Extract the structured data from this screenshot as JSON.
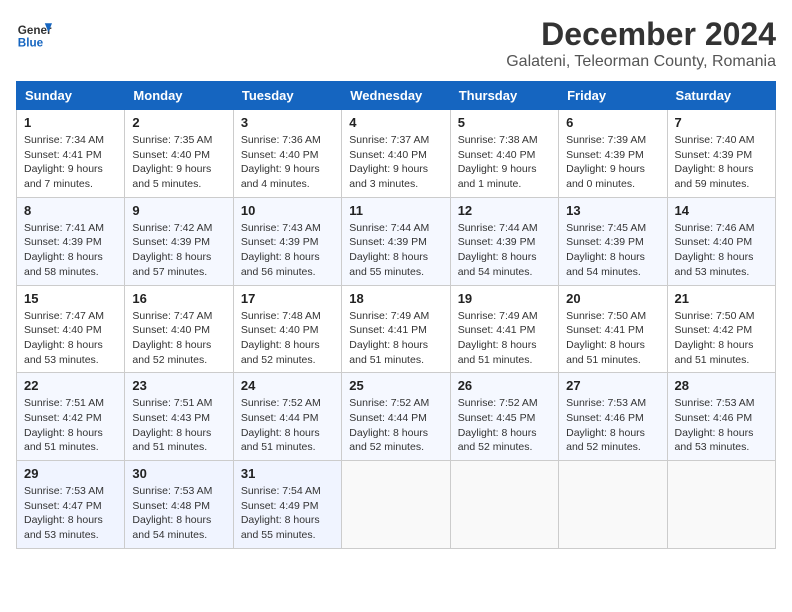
{
  "header": {
    "logo_general": "General",
    "logo_blue": "Blue",
    "month_title": "December 2024",
    "location": "Galateni, Teleorman County, Romania"
  },
  "calendar": {
    "days_of_week": [
      "Sunday",
      "Monday",
      "Tuesday",
      "Wednesday",
      "Thursday",
      "Friday",
      "Saturday"
    ],
    "weeks": [
      [
        null,
        {
          "day": "2",
          "sunrise": "Sunrise: 7:35 AM",
          "sunset": "Sunset: 4:40 PM",
          "daylight": "Daylight: 9 hours and 5 minutes."
        },
        {
          "day": "3",
          "sunrise": "Sunrise: 7:36 AM",
          "sunset": "Sunset: 4:40 PM",
          "daylight": "Daylight: 9 hours and 4 minutes."
        },
        {
          "day": "4",
          "sunrise": "Sunrise: 7:37 AM",
          "sunset": "Sunset: 4:40 PM",
          "daylight": "Daylight: 9 hours and 3 minutes."
        },
        {
          "day": "5",
          "sunrise": "Sunrise: 7:38 AM",
          "sunset": "Sunset: 4:40 PM",
          "daylight": "Daylight: 9 hours and 1 minute."
        },
        {
          "day": "6",
          "sunrise": "Sunrise: 7:39 AM",
          "sunset": "Sunset: 4:39 PM",
          "daylight": "Daylight: 9 hours and 0 minutes."
        },
        {
          "day": "7",
          "sunrise": "Sunrise: 7:40 AM",
          "sunset": "Sunset: 4:39 PM",
          "daylight": "Daylight: 8 hours and 59 minutes."
        }
      ],
      [
        {
          "day": "1",
          "sunrise": "Sunrise: 7:34 AM",
          "sunset": "Sunset: 4:41 PM",
          "daylight": "Daylight: 9 hours and 7 minutes."
        },
        {
          "day": "9",
          "sunrise": "Sunrise: 7:42 AM",
          "sunset": "Sunset: 4:39 PM",
          "daylight": "Daylight: 8 hours and 57 minutes."
        },
        {
          "day": "10",
          "sunrise": "Sunrise: 7:43 AM",
          "sunset": "Sunset: 4:39 PM",
          "daylight": "Daylight: 8 hours and 56 minutes."
        },
        {
          "day": "11",
          "sunrise": "Sunrise: 7:44 AM",
          "sunset": "Sunset: 4:39 PM",
          "daylight": "Daylight: 8 hours and 55 minutes."
        },
        {
          "day": "12",
          "sunrise": "Sunrise: 7:44 AM",
          "sunset": "Sunset: 4:39 PM",
          "daylight": "Daylight: 8 hours and 54 minutes."
        },
        {
          "day": "13",
          "sunrise": "Sunrise: 7:45 AM",
          "sunset": "Sunset: 4:39 PM",
          "daylight": "Daylight: 8 hours and 54 minutes."
        },
        {
          "day": "14",
          "sunrise": "Sunrise: 7:46 AM",
          "sunset": "Sunset: 4:40 PM",
          "daylight": "Daylight: 8 hours and 53 minutes."
        }
      ],
      [
        {
          "day": "8",
          "sunrise": "Sunrise: 7:41 AM",
          "sunset": "Sunset: 4:39 PM",
          "daylight": "Daylight: 8 hours and 58 minutes."
        },
        {
          "day": "16",
          "sunrise": "Sunrise: 7:47 AM",
          "sunset": "Sunset: 4:40 PM",
          "daylight": "Daylight: 8 hours and 52 minutes."
        },
        {
          "day": "17",
          "sunrise": "Sunrise: 7:48 AM",
          "sunset": "Sunset: 4:40 PM",
          "daylight": "Daylight: 8 hours and 52 minutes."
        },
        {
          "day": "18",
          "sunrise": "Sunrise: 7:49 AM",
          "sunset": "Sunset: 4:41 PM",
          "daylight": "Daylight: 8 hours and 51 minutes."
        },
        {
          "day": "19",
          "sunrise": "Sunrise: 7:49 AM",
          "sunset": "Sunset: 4:41 PM",
          "daylight": "Daylight: 8 hours and 51 minutes."
        },
        {
          "day": "20",
          "sunrise": "Sunrise: 7:50 AM",
          "sunset": "Sunset: 4:41 PM",
          "daylight": "Daylight: 8 hours and 51 minutes."
        },
        {
          "day": "21",
          "sunrise": "Sunrise: 7:50 AM",
          "sunset": "Sunset: 4:42 PM",
          "daylight": "Daylight: 8 hours and 51 minutes."
        }
      ],
      [
        {
          "day": "15",
          "sunrise": "Sunrise: 7:47 AM",
          "sunset": "Sunset: 4:40 PM",
          "daylight": "Daylight: 8 hours and 53 minutes."
        },
        {
          "day": "23",
          "sunrise": "Sunrise: 7:51 AM",
          "sunset": "Sunset: 4:43 PM",
          "daylight": "Daylight: 8 hours and 51 minutes."
        },
        {
          "day": "24",
          "sunrise": "Sunrise: 7:52 AM",
          "sunset": "Sunset: 4:44 PM",
          "daylight": "Daylight: 8 hours and 51 minutes."
        },
        {
          "day": "25",
          "sunrise": "Sunrise: 7:52 AM",
          "sunset": "Sunset: 4:44 PM",
          "daylight": "Daylight: 8 hours and 52 minutes."
        },
        {
          "day": "26",
          "sunrise": "Sunrise: 7:52 AM",
          "sunset": "Sunset: 4:45 PM",
          "daylight": "Daylight: 8 hours and 52 minutes."
        },
        {
          "day": "27",
          "sunrise": "Sunrise: 7:53 AM",
          "sunset": "Sunset: 4:46 PM",
          "daylight": "Daylight: 8 hours and 52 minutes."
        },
        {
          "day": "28",
          "sunrise": "Sunrise: 7:53 AM",
          "sunset": "Sunset: 4:46 PM",
          "daylight": "Daylight: 8 hours and 53 minutes."
        }
      ],
      [
        {
          "day": "22",
          "sunrise": "Sunrise: 7:51 AM",
          "sunset": "Sunset: 4:42 PM",
          "daylight": "Daylight: 8 hours and 51 minutes."
        },
        {
          "day": "30",
          "sunrise": "Sunrise: 7:53 AM",
          "sunset": "Sunset: 4:48 PM",
          "daylight": "Daylight: 8 hours and 54 minutes."
        },
        {
          "day": "31",
          "sunrise": "Sunrise: 7:54 AM",
          "sunset": "Sunset: 4:49 PM",
          "daylight": "Daylight: 8 hours and 55 minutes."
        },
        null,
        null,
        null,
        null
      ],
      [
        {
          "day": "29",
          "sunrise": "Sunrise: 7:53 AM",
          "sunset": "Sunset: 4:47 PM",
          "daylight": "Daylight: 8 hours and 53 minutes."
        },
        null,
        null,
        null,
        null,
        null,
        null
      ]
    ]
  }
}
